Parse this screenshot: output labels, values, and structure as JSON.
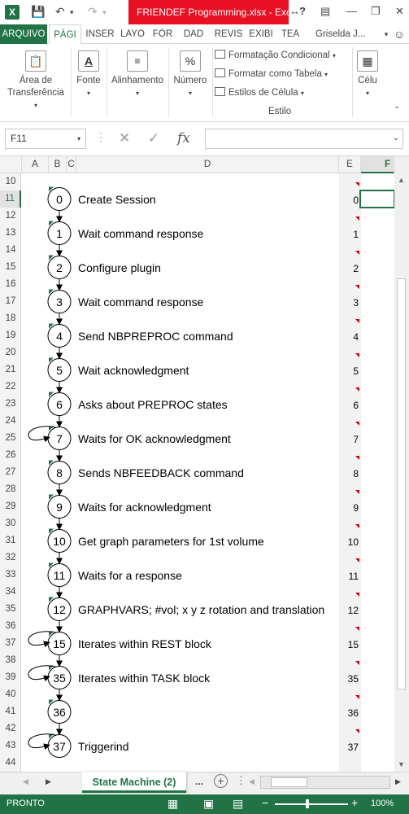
{
  "window": {
    "title": "FRIENDEF Programming.xlsx - Excel",
    "app_icon": "X"
  },
  "ribbon_tabs": [
    "ARQUIVO",
    "PÁGI",
    "INSER",
    "LAYO",
    "FÓR",
    "DAD",
    "REVIS",
    "EXIBI",
    "TEA"
  ],
  "account": "Griselda J...",
  "ribbon": {
    "clipboard_label": "Área de Transferência",
    "font_label": "Fonte",
    "alignment_label": "Alinhamento",
    "number_label": "Número",
    "number_icon": "%",
    "conditional_format": "Formatação Condicional",
    "format_as_table": "Formatar como Tabela",
    "cell_styles": "Estilos de Célula",
    "style_group": "Estilo",
    "cells_label": "Célu"
  },
  "formula_bar": {
    "name_box": "F11",
    "fx": "fx",
    "formula": ""
  },
  "columns": [
    "A",
    "B",
    "C",
    "D",
    "E",
    "F"
  ],
  "selected_column": "F",
  "selected_row": "11",
  "first_row": 10,
  "rows": [
    "10",
    "11",
    "12",
    "13",
    "14",
    "15",
    "16",
    "17",
    "18",
    "19",
    "20",
    "21",
    "22",
    "23",
    "24",
    "25",
    "26",
    "27",
    "28",
    "29",
    "30",
    "31",
    "32",
    "33",
    "34",
    "35",
    "36",
    "37",
    "38",
    "39",
    "40",
    "41",
    "42",
    "43",
    "44"
  ],
  "states": [
    {
      "id": "0",
      "label": "Create Session",
      "e": "0",
      "self_loop": false
    },
    {
      "id": "1",
      "label": "Wait command response",
      "e": "1",
      "self_loop": false
    },
    {
      "id": "2",
      "label": "Configure plugin",
      "e": "2",
      "self_loop": false
    },
    {
      "id": "3",
      "label": "Wait command response",
      "e": "3",
      "self_loop": false
    },
    {
      "id": "4",
      "label": "Send NBPREPROC command",
      "e": "4",
      "self_loop": false
    },
    {
      "id": "5",
      "label": "Wait acknowledgment",
      "e": "5",
      "self_loop": false
    },
    {
      "id": "6",
      "label": "Asks about PREPROC states",
      "e": "6",
      "self_loop": false
    },
    {
      "id": "7",
      "label": "Waits for OK acknowledgment",
      "e": "7",
      "self_loop": true
    },
    {
      "id": "8",
      "label": "Sends NBFEEDBACK command",
      "e": "8",
      "self_loop": false
    },
    {
      "id": "9",
      "label": "Waits for acknowledgment",
      "e": "9",
      "self_loop": false
    },
    {
      "id": "10",
      "label": "Get graph parameters for 1st volume",
      "e": "10",
      "self_loop": false
    },
    {
      "id": "11",
      "label": "Waits for a response",
      "e": "11",
      "self_loop": false
    },
    {
      "id": "12",
      "label": "GRAPHVARS; #vol; x y z rotation and translation",
      "e": "12",
      "self_loop": false
    },
    {
      "id": "15",
      "label": "Iterates within REST block",
      "e": "15",
      "self_loop": true
    },
    {
      "id": "35",
      "label": "Iterates within TASK block",
      "e": "35",
      "self_loop": true
    },
    {
      "id": "36",
      "label": "",
      "e": "36",
      "self_loop": false
    },
    {
      "id": "37",
      "label": "Triggerind",
      "e": "37",
      "self_loop": true
    }
  ],
  "sheet_tab": "State Machine (2)",
  "sheet_more": "...",
  "status": {
    "ready": "PRONTO",
    "zoom": "100%"
  }
}
